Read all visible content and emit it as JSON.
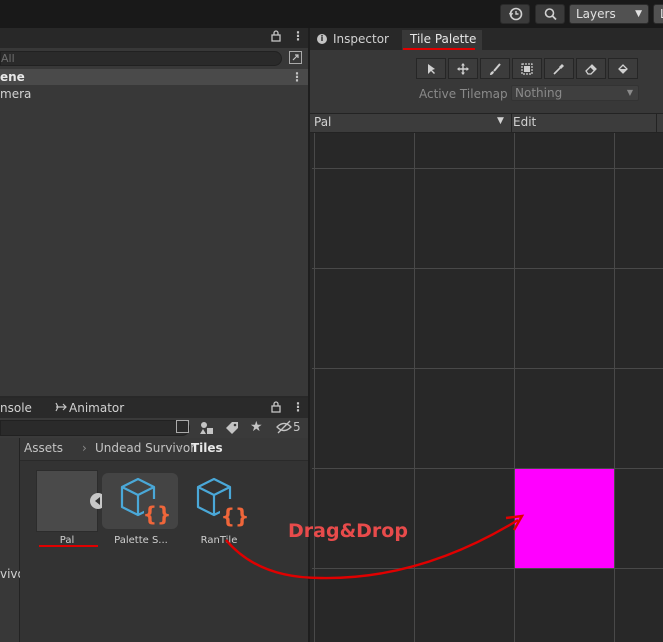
{
  "toolbar": {
    "layers_label": "Layers",
    "layout_label": "L"
  },
  "hierarchy": {
    "search_placeholder": "All",
    "scene_label": "ene",
    "camera_label": "mera"
  },
  "project": {
    "tabs": [
      {
        "label": "nsole"
      },
      {
        "label": "Animator"
      }
    ],
    "badge_count": "5",
    "breadcrumb": [
      "Assets",
      "Undead Survivor",
      "Tiles"
    ],
    "side_label": "vivor",
    "assets": [
      {
        "label": "Pal"
      },
      {
        "label": "Palette S..."
      },
      {
        "label": "RanTile"
      }
    ]
  },
  "inspector_tabs": [
    {
      "label": "Inspector"
    },
    {
      "label": "Tile Palette"
    }
  ],
  "tile_palette": {
    "active_tilemap_label": "Active Tilemap",
    "active_tilemap_value": "Nothing",
    "palette_dropdown": "Pal",
    "edit_label": "Edit"
  },
  "annotation": {
    "text": "Drag&Drop",
    "color": "#e84b4b"
  },
  "colors": {
    "painted_tile": "#ff00ff",
    "annotation_red": "#e00000",
    "icon_blue": "#4aa8d8",
    "icon_orange": "#f0663a"
  }
}
